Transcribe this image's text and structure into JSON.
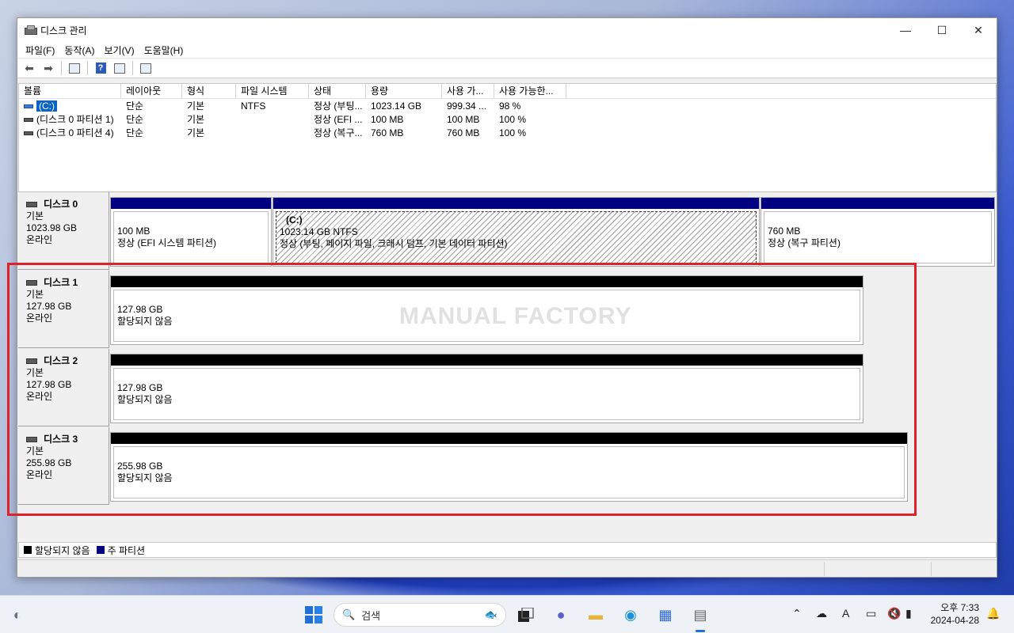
{
  "window": {
    "title": "디스크 관리"
  },
  "window_controls": {
    "minimize": "—",
    "maximize": "☐",
    "close": "✕"
  },
  "menu": [
    "파일(F)",
    "동작(A)",
    "보기(V)",
    "도움말(H)"
  ],
  "volume_list": {
    "headers": [
      "볼륨",
      "레이아웃",
      "형식",
      "파일 시스템",
      "상태",
      "용량",
      "사용 가...",
      "사용 가능한..."
    ],
    "rows": [
      [
        "(C:)",
        "단순",
        "기본",
        "NTFS",
        "정상 (부팅...",
        "1023.14 GB",
        "999.34 ...",
        "98 %"
      ],
      [
        "(디스크 0 파티션 1)",
        "단순",
        "기본",
        "",
        "정상 (EFI ...",
        "100 MB",
        "100 MB",
        "100 %"
      ],
      [
        "(디스크 0 파티션 4)",
        "단순",
        "기본",
        "",
        "정상 (복구...",
        "760 MB",
        "760 MB",
        "100 %"
      ]
    ]
  },
  "disks": [
    {
      "name": "디스크 0",
      "type": "기본",
      "size": "1023.98 GB",
      "status": "온라인",
      "partitions": [
        {
          "label": "",
          "size": "100 MB",
          "desc": "정상 (EFI 시스템 파티션)"
        },
        {
          "label": "(C:)",
          "size": "1023.14 GB NTFS",
          "desc": "정상 (부팅, 페이지 파일, 크래시 덤프, 기본 데이터 파티션)"
        },
        {
          "label": "",
          "size": "760 MB",
          "desc": "정상 (복구 파티션)"
        }
      ]
    },
    {
      "name": "디스크 1",
      "type": "기본",
      "size": "127.98 GB",
      "status": "온라인",
      "partitions": [
        {
          "size": "127.98 GB",
          "desc": "할당되지 않음"
        }
      ]
    },
    {
      "name": "디스크 2",
      "type": "기본",
      "size": "127.98 GB",
      "status": "온라인",
      "partitions": [
        {
          "size": "127.98 GB",
          "desc": "할당되지 않음"
        }
      ]
    },
    {
      "name": "디스크 3",
      "type": "기본",
      "size": "255.98 GB",
      "status": "온라인",
      "partitions": [
        {
          "size": "255.98 GB",
          "desc": "할당되지 않음"
        }
      ]
    }
  ],
  "legend": {
    "unallocated": "할당되지 않음",
    "primary": "주 파티션",
    "unallocated_color": "#000000",
    "primary_color": "#000080"
  },
  "watermark": "MANUAL FACTORY",
  "taskbar": {
    "search_label": "검색",
    "time": "오후 7:33",
    "date": "2024-04-28"
  }
}
